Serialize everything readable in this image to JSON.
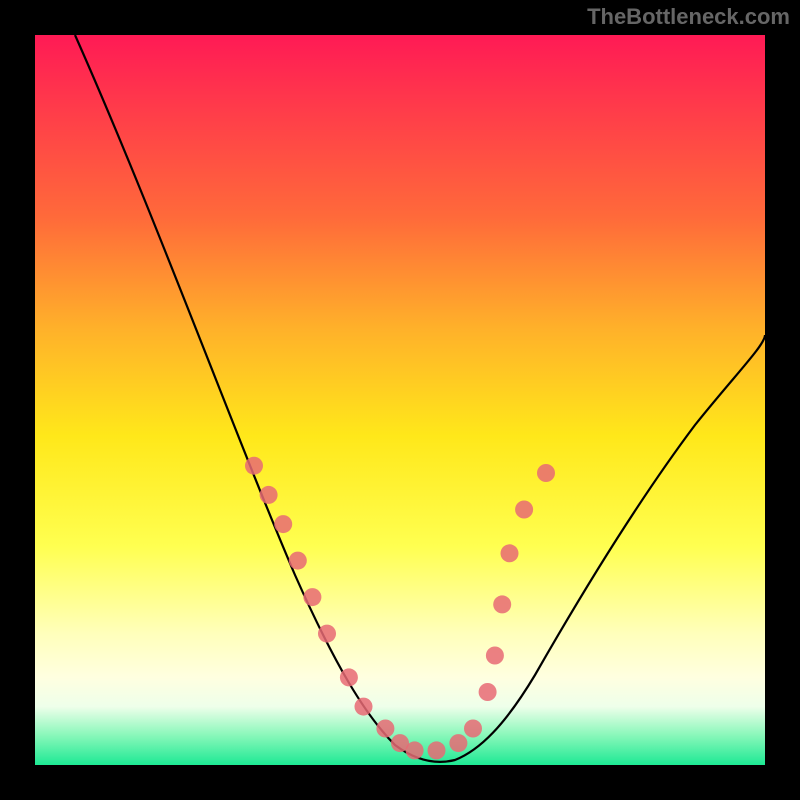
{
  "watermark": "TheBottleneck.com",
  "chart_data": {
    "type": "line",
    "title": "",
    "xlabel": "",
    "ylabel": "",
    "xlim": [
      0,
      100
    ],
    "ylim": [
      0,
      100
    ],
    "series": [
      {
        "name": "bottleneck-curve",
        "x": [
          5,
          10,
          15,
          20,
          25,
          30,
          35,
          40,
          45,
          50,
          55,
          60,
          65,
          70,
          75,
          80,
          85,
          90,
          95,
          100
        ],
        "y": [
          100,
          90,
          80,
          70,
          60,
          50,
          40,
          30,
          20,
          8,
          2,
          0,
          5,
          15,
          28,
          40,
          50,
          58,
          62,
          65
        ]
      }
    ],
    "scatter_points": {
      "name": "sample-dots",
      "x": [
        30,
        32,
        34,
        36,
        38,
        40,
        43,
        45,
        48,
        50,
        52,
        55,
        58,
        60,
        62,
        63,
        64,
        65,
        67,
        70
      ],
      "y": [
        41,
        37,
        33,
        28,
        23,
        18,
        12,
        8,
        5,
        3,
        2,
        2,
        3,
        5,
        10,
        15,
        22,
        29,
        35,
        40
      ]
    },
    "gradient": {
      "top_color": "#ff1a55",
      "mid_color": "#ffe81a",
      "bottom_color": "#1de994"
    }
  }
}
